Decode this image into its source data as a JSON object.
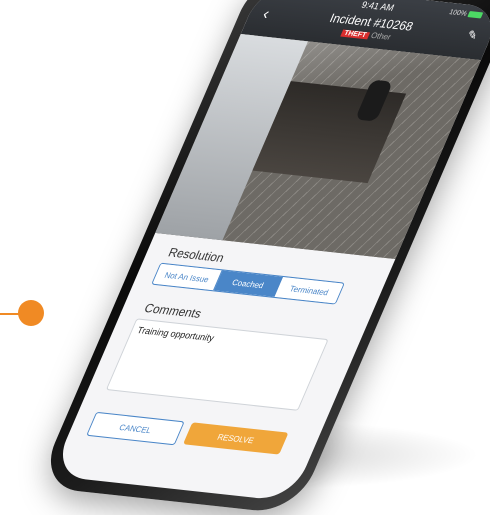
{
  "status": {
    "time": "9:41 AM",
    "battery": "100%"
  },
  "header": {
    "title": "Incident #10268",
    "category": "THEFT",
    "subcategory": "Other"
  },
  "resolution": {
    "label": "Resolution",
    "options": [
      "Not An Issue",
      "Coached",
      "Terminated"
    ],
    "selected": "Coached"
  },
  "comments": {
    "label": "Comments",
    "value": "Training opportunity"
  },
  "actions": {
    "cancel": "CANCEL",
    "resolve": "RESOLVE"
  },
  "colors": {
    "accent": "#f08a24",
    "primary": "#4a86c8",
    "resolve": "#f0a63a",
    "theft": "#d92e2e"
  }
}
